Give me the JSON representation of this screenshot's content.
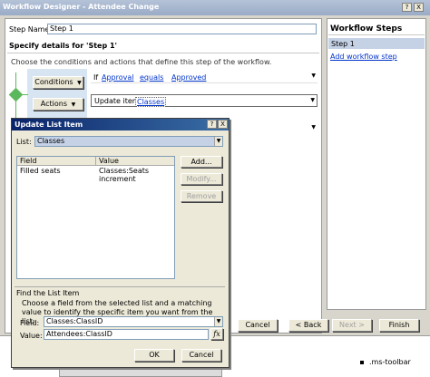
{
  "window": {
    "title": "Workflow Designer - Attendee Change",
    "buttons": [
      "?",
      "X"
    ]
  },
  "step": {
    "label": "Step Name:",
    "value": "Step 1",
    "details_heading": "Specify details for 'Step 1'",
    "instructions": "Choose the conditions and actions that define this step of the workflow."
  },
  "conditions": {
    "button": "Conditions",
    "prefix": "If",
    "field": "Approval",
    "operator": "equals",
    "value": "Approved"
  },
  "actions": {
    "button": "Actions",
    "text": "Update item in",
    "list": "Classes"
  },
  "workflow_steps": {
    "title": "Workflow Steps",
    "current": "Step 1",
    "add_link": "Add workflow step"
  },
  "bottom_buttons": {
    "cancel": "Cancel",
    "back": "< Back",
    "next": "Next >",
    "finish": "Finish"
  },
  "taskbar": {
    "toolbar_text": ".ms-toolbar"
  },
  "dialog": {
    "title": "Update List Item",
    "buttons": [
      "?",
      "X"
    ],
    "list_label": "List:",
    "list_value": "Classes",
    "table": {
      "headers": [
        "Field",
        "Value"
      ],
      "rows": [
        {
          "field": "Filled seats",
          "value": "Classes:Seats increment"
        }
      ]
    },
    "add": "Add...",
    "modify": "Modify...",
    "remove": "Remove",
    "find_heading": "Find the List Item",
    "find_instructions": "Choose a field from the selected list and a matching value to identify the specific item you want from the list:",
    "field_label": "Field:",
    "field_value": "Classes:ClassID",
    "value_label": "Value:",
    "value_value": "Attendees:ClassID",
    "fx": "fx",
    "ok": "OK",
    "cancel": "Cancel"
  },
  "colors": {
    "title_bar": "#a7b7cf",
    "dialog_title": "#0a246a",
    "condition_band": "#d7e5f2",
    "accent_green": "#5cb85c",
    "selected_list": "#c5d2e6"
  }
}
